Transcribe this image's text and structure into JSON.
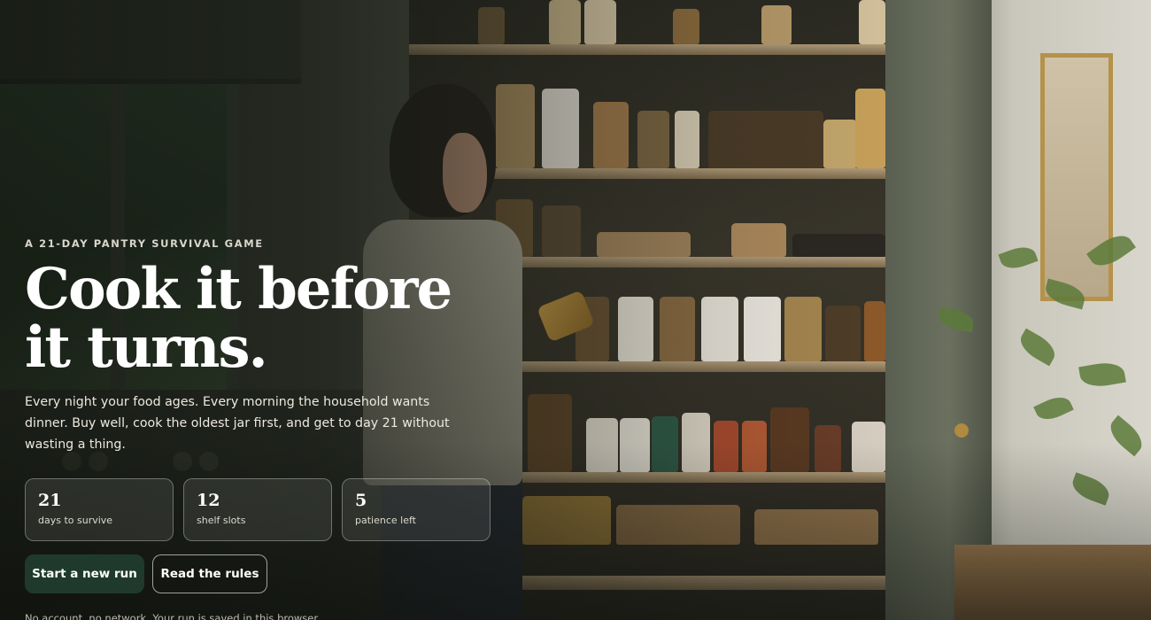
{
  "colors": {
    "primary_button": "#1f3a2c",
    "text": "#ffffff",
    "muted_text": "#dcd9cf"
  },
  "hero": {
    "eyebrow": "A 21-DAY PANTRY SURVIVAL GAME",
    "title_line1": "Cook it before",
    "title_line2": "it turns.",
    "lede": "Every night your food ages. Every morning the household wants dinner. Buy well, cook the oldest jar first, and get to day 21 without wasting a thing."
  },
  "stats": [
    {
      "value": "21",
      "label": "days to survive"
    },
    {
      "value": "12",
      "label": "shelf slots"
    },
    {
      "value": "5",
      "label": "patience left"
    }
  ],
  "actions": {
    "primary_label": "Start a new run",
    "secondary_label": "Read the rules"
  },
  "footnote": "No account, no network. Your run is saved in this browser."
}
